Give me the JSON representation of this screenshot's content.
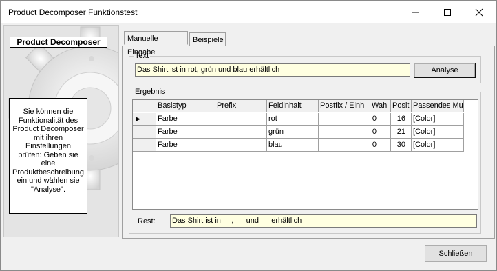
{
  "window": {
    "title": "Product Decomposer Funktionstest"
  },
  "left_panel": {
    "brand": "Product Decomposer",
    "info": "Sie können die\nFunktionalität des\nProduct Decomposer\nmit ihren\nEinstellungen\nprüfen: Geben sie\neine\nProduktbeschreibung\nein und wählen sie\n\"Analyse\"."
  },
  "tabs": [
    {
      "label": "Manuelle Eingabe",
      "active": true
    },
    {
      "label": "Beispiele",
      "active": false
    }
  ],
  "text_group": {
    "label": "Text",
    "input_value": "Das Shirt ist in rot, grün und blau erhältlich",
    "analyse_label": "Analyse"
  },
  "result_group": {
    "label": "Ergebnis",
    "columns": [
      "Basistyp",
      "Prefix",
      "Feldinhalt",
      "Postfix / Einh",
      "Wah",
      "Posit",
      "Passendes Mu"
    ],
    "rows": [
      [
        "Farbe",
        "",
        "rot",
        "",
        "0",
        "16",
        "[Color]"
      ],
      [
        "Farbe",
        "",
        "grün",
        "",
        "0",
        "21",
        "[Color]"
      ],
      [
        "Farbe",
        "",
        "blau",
        "",
        "0",
        "30",
        "[Color]"
      ]
    ],
    "current_row_marker": "▶",
    "rest_label": "Rest:",
    "rest_value": "Das Shirt ist in     ,      und      erhältlich"
  },
  "footer": {
    "close_label": "Schließen"
  },
  "colors": {
    "input_bg": "#ffffe1",
    "dialog_bg": "#f0f0f0"
  }
}
